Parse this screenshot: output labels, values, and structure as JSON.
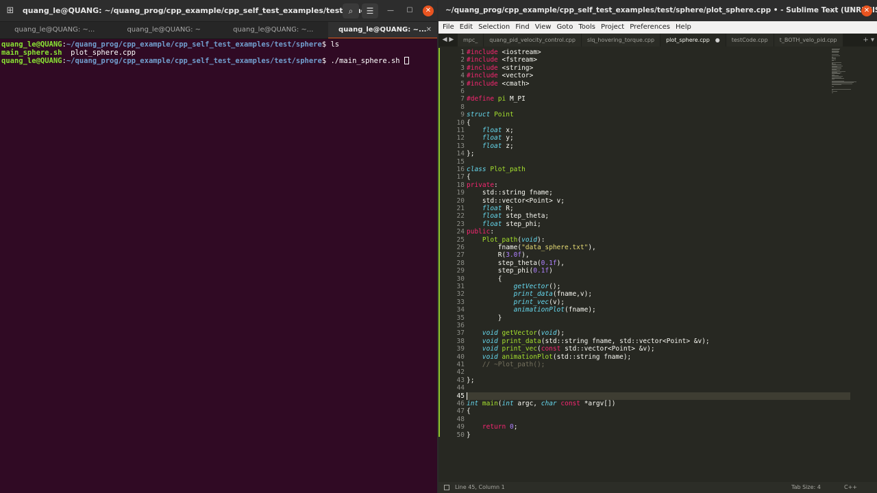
{
  "terminal": {
    "title": "quang_le@QUANG: ~/quang_prog/cpp_example/cpp_self_test_examples/test/sphere",
    "tabs": [
      {
        "label": "quang_le@QUANG: ~..."
      },
      {
        "label": "quang_le@QUANG: ~"
      },
      {
        "label": "quang_le@QUANG: ~..."
      },
      {
        "label": "quang_le@QUANG: ~..."
      }
    ],
    "lines": [
      {
        "user": "quang_le@QUANG",
        "sep": ":",
        "path": "~/quang_prog/cpp_example/cpp_self_test_examples/test/sphere",
        "cmd": "$ ls"
      },
      {
        "exec_file": "main_sphere.sh",
        "other_file": "  plot_sphere.cpp"
      },
      {
        "user": "quang_le@QUANG",
        "sep": ":",
        "path": "~/quang_prog/cpp_example/cpp_self_test_examples/test/sphere",
        "cmd": "$ ./main_sphere.sh "
      }
    ],
    "colors": {
      "background": "#300a24",
      "user": "#8ae234",
      "path": "#729fcf",
      "accent": "#e95420"
    }
  },
  "sublime": {
    "title": "~/quang_prog/cpp_example/cpp_self_test_examples/test/sphere/plot_sphere.cpp • - Sublime Text (UNREGISTE...",
    "menu": [
      "File",
      "Edit",
      "Selection",
      "Find",
      "View",
      "Goto",
      "Tools",
      "Project",
      "Preferences",
      "Help"
    ],
    "tabs": [
      {
        "label": "mpc_"
      },
      {
        "label": "quang_pid_velocity_control.cpp"
      },
      {
        "label": "slq_hovering_torque.cpp"
      },
      {
        "label": "plot_sphere.cpp",
        "dirty": "●"
      },
      {
        "label": "testCode.cpp"
      },
      {
        "label": "t_BOTH_velo_pid.cpp"
      }
    ],
    "line_numbers": [
      "1",
      "2",
      "3",
      "4",
      "5",
      "6",
      "7",
      "8",
      "9",
      "10",
      "11",
      "12",
      "13",
      "14",
      "15",
      "16",
      "17",
      "18",
      "19",
      "20",
      "21",
      "22",
      "23",
      "24",
      "25",
      "26",
      "27",
      "28",
      "29",
      "30",
      "31",
      "32",
      "33",
      "34",
      "35",
      "36",
      "37",
      "38",
      "39",
      "40",
      "41",
      "42",
      "43",
      "44",
      "45",
      "46",
      "47",
      "48",
      "49",
      "50"
    ],
    "status": {
      "position": "Line 45, Column 1",
      "tab_size": "Tab Size: 4",
      "syntax": "C++"
    },
    "colors": {
      "background": "#272822",
      "keyword": "#f92672",
      "type": "#66d9ef",
      "string": "#e6db74",
      "number": "#ae81ff",
      "function": "#a6e22e",
      "comment": "#75715e"
    }
  }
}
